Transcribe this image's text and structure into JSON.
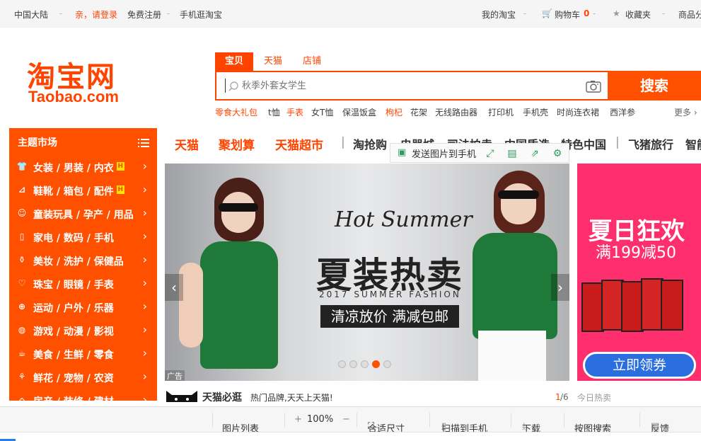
{
  "topbar": {
    "region": "中国大陆",
    "login": "亲，请登录",
    "register": "免费注册",
    "mobile": "手机逛淘宝",
    "my_taobao": "我的淘宝",
    "cart_label": "购物车",
    "cart_count": "0",
    "favorites": "收藏夹",
    "more": "商品分"
  },
  "logo": {
    "cn": "淘宝网",
    "en": "Taobao.com"
  },
  "search": {
    "tabs": [
      "宝贝",
      "天猫",
      "店铺"
    ],
    "placeholder": "秋季外套女学生",
    "button": "搜索",
    "hotwords": [
      "零食大礼包",
      "t恤",
      "手表",
      "女T恤",
      "保温饭盒",
      "枸杞",
      "花架",
      "无线路由器",
      "打印机",
      "手机壳",
      "时尚连衣裙",
      "西洋参"
    ],
    "more": "更多"
  },
  "sidebar": {
    "title": "主题市场",
    "items": [
      {
        "label": "女装 / 男装 / 内衣",
        "hot": "H"
      },
      {
        "label": "鞋靴 / 箱包 / 配件",
        "hot": "H"
      },
      {
        "label": "童装玩具 / 孕产 / 用品",
        "hot": ""
      },
      {
        "label": "家电 / 数码 / 手机",
        "hot": ""
      },
      {
        "label": "美妆 / 洗护 / 保健品",
        "hot": ""
      },
      {
        "label": "珠宝 / 眼镜 / 手表",
        "hot": ""
      },
      {
        "label": "运动 / 户外 / 乐器",
        "hot": ""
      },
      {
        "label": "游戏 / 动漫 / 影视",
        "hot": ""
      },
      {
        "label": "美食 / 生鲜 / 零食",
        "hot": ""
      },
      {
        "label": "鲜花 / 宠物 / 农资",
        "hot": ""
      },
      {
        "label": "房产 / 装修 / 建材",
        "hot": ""
      }
    ]
  },
  "nav": {
    "primary": [
      "天猫",
      "聚划算",
      "天猫超市"
    ],
    "secondary": [
      "淘抢购",
      "电器城",
      "司法拍卖",
      "中国质造",
      "特色中国",
      "飞猪旅行",
      "智能"
    ]
  },
  "popbar": {
    "send_to_phone": "发送图片到手机"
  },
  "banner": {
    "script_title": "Hot Summer",
    "headline": "夏装热卖",
    "subline": "2017 SUMMER FASHION",
    "tagline": "清凉放价  满减包邮",
    "ad_label": "广告",
    "dot_count": 5,
    "active_dot": 4
  },
  "side_ad": {
    "title": "夏日狂欢",
    "subtitle": "满199减50",
    "button": "立即领券"
  },
  "tmall_bar": {
    "title": "天猫必逛",
    "slogan": "热门品牌,天天上天猫!",
    "page_current": "1",
    "page_total": "/6",
    "today_hot": "今日热卖"
  },
  "viewer_toolbar": {
    "image_list": "图片列表",
    "zoom_in": "+",
    "zoom": "100%",
    "zoom_out": "−",
    "fit": "合适尺寸",
    "scan": "扫描到手机",
    "download": "下载",
    "image_search": "按图搜索",
    "feedback": "反馈"
  },
  "colors": {
    "brand": "#ff5000",
    "accent": "#f40"
  }
}
